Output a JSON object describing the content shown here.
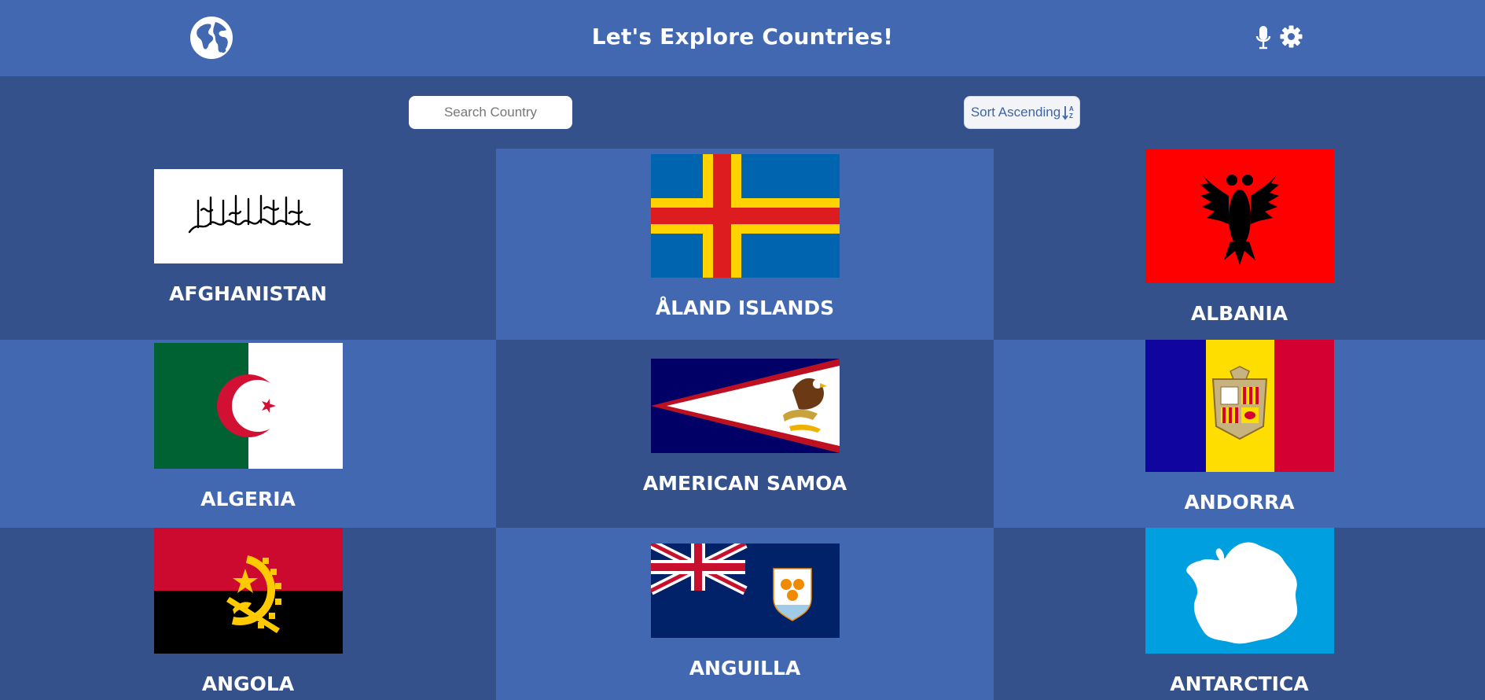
{
  "header": {
    "title": "Let's Explore Countries!",
    "logo_icon": "globe-icon",
    "voice_icon": "microphone-icon",
    "settings_icon": "gear-icon",
    "color": "#4268b1"
  },
  "controls": {
    "search_placeholder": "Search Country",
    "search_value": "",
    "sort_label": "Sort Ascending",
    "sort_icon": "sort-az-icon"
  },
  "theme": {
    "background_dark": "#34518b",
    "background_light": "#4268b1"
  },
  "countries": [
    {
      "name": "Afghanistan",
      "flag": "afghanistan-flag"
    },
    {
      "name": "Åland Islands",
      "flag": "aland-islands-flag"
    },
    {
      "name": "Albania",
      "flag": "albania-flag"
    },
    {
      "name": "Algeria",
      "flag": "algeria-flag"
    },
    {
      "name": "American Samoa",
      "flag": "american-samoa-flag"
    },
    {
      "name": "Andorra",
      "flag": "andorra-flag"
    },
    {
      "name": "Angola",
      "flag": "angola-flag"
    },
    {
      "name": "Anguilla",
      "flag": "anguilla-flag"
    },
    {
      "name": "Antarctica",
      "flag": "antarctica-flag"
    }
  ]
}
